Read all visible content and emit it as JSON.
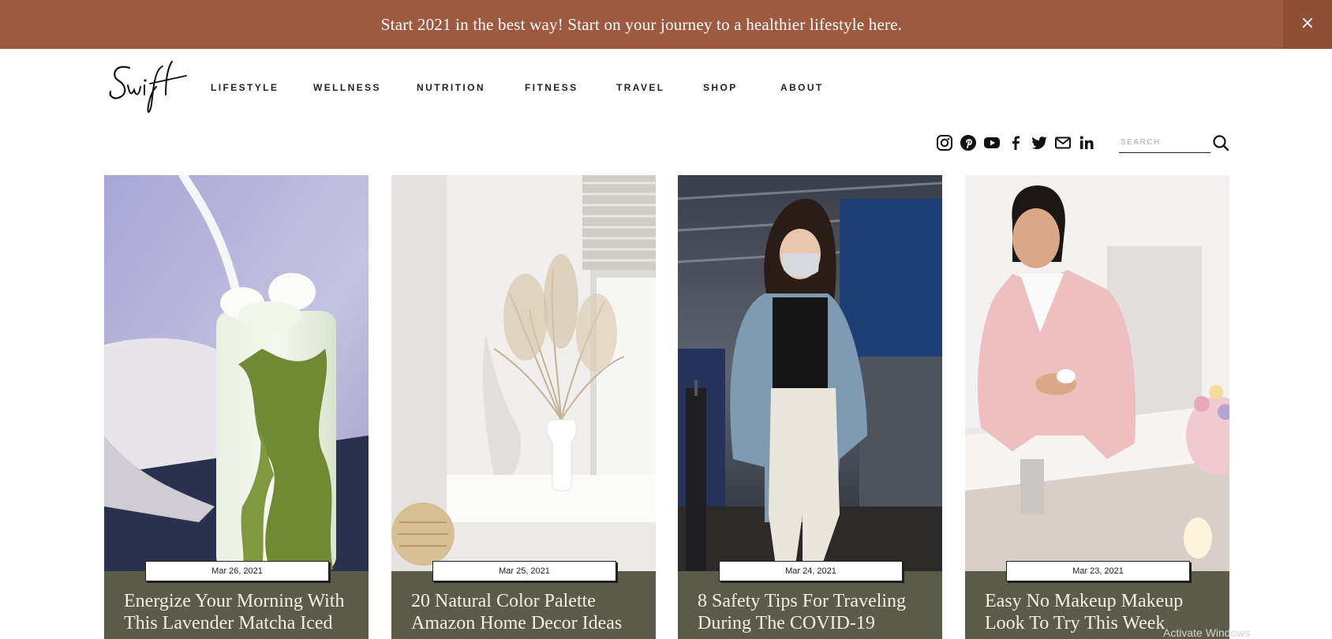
{
  "banner": {
    "text": "Start 2021 in the best way! Start on your journey to a healthier lifestyle here.",
    "close_label": "×"
  },
  "logo": {
    "text": "Swift"
  },
  "nav": {
    "items": [
      "LIFESTYLE",
      "WELLNESS",
      "NUTRITION",
      "FITNESS",
      "TRAVEL",
      "SHOP",
      "ABOUT"
    ]
  },
  "social": {
    "icons": [
      "instagram-icon",
      "pinterest-icon",
      "youtube-icon",
      "facebook-icon",
      "twitter-icon",
      "email-icon",
      "linkedin-icon"
    ]
  },
  "search": {
    "placeholder": "SEARCH"
  },
  "colors": {
    "banner": "#9e5a41",
    "card_panel": "#5b5b49",
    "title_text": "#f4efe6"
  },
  "posts": [
    {
      "date": "Mar 26, 2021",
      "title": "Energize Your Morning With This Lavender Matcha Iced"
    },
    {
      "date": "Mar 25, 2021",
      "title": "20 Natural Color Palette Amazon Home Decor Ideas"
    },
    {
      "date": "Mar 24, 2021",
      "title": "8 Safety Tips For Traveling During The COVID-19"
    },
    {
      "date": "Mar 23, 2021",
      "title": "Easy No Makeup Makeup Look To Try This Week"
    }
  ],
  "watermark": "Activate Windows"
}
